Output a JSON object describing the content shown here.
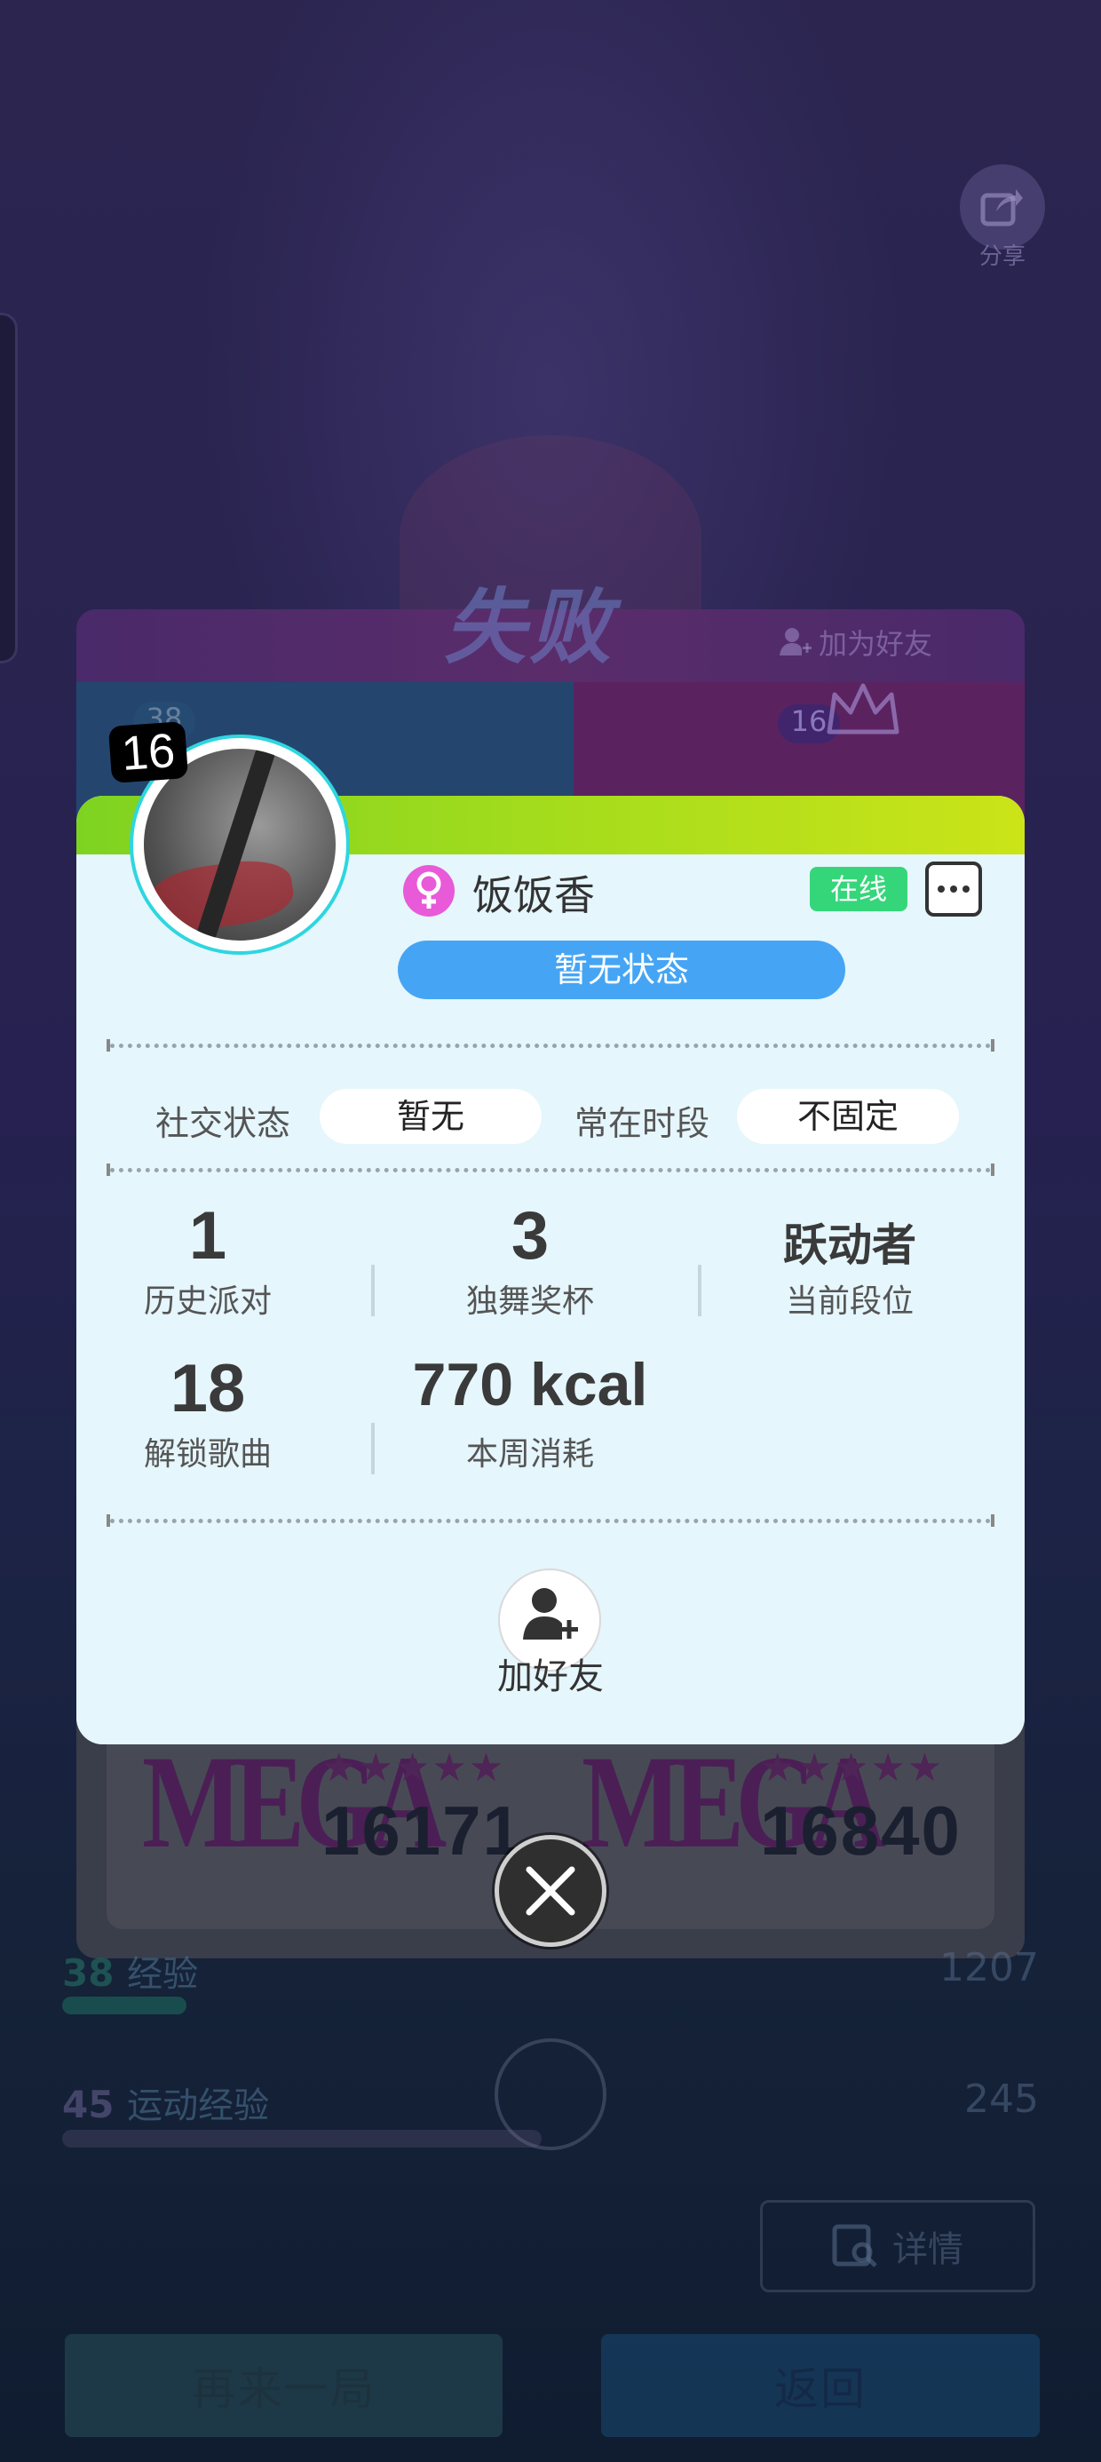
{
  "background": {
    "share_label": "分享",
    "result_title": "失败",
    "add_friend_label": "加为好友",
    "left_level": "38",
    "right_level": "16",
    "left_rating": "MEGA",
    "right_rating": "MEGA",
    "left_stars": "★★★★★",
    "right_stars": "★★★★★",
    "left_score": "16171",
    "right_score": "16840",
    "xp": {
      "level": "38",
      "label": "经验",
      "value": "1207",
      "fill": 0.18
    },
    "sport_xp": {
      "level": "45",
      "label": "运动经验",
      "value": "245",
      "fill": 0.49
    },
    "detail_label": "详情",
    "replay_label": "再来一局",
    "back_label": "返回"
  },
  "profile": {
    "level": "16",
    "username": "饭饭香",
    "gender_icon": "female-icon",
    "online_status": "在线",
    "status_text": "暂无状态",
    "social_status_label": "社交状态",
    "social_status_value": "暂无",
    "active_time_label": "常在时段",
    "active_time_value": "不固定",
    "stats": {
      "parties": {
        "value": "1",
        "label": "历史派对"
      },
      "solo_trophies": {
        "value": "3",
        "label": "独舞奖杯"
      },
      "rank": {
        "value": "跃动者",
        "label": "当前段位"
      },
      "songs_unlocked": {
        "value": "18",
        "label": "解锁歌曲"
      },
      "weekly_kcal": {
        "value": "770 kcal",
        "label": "本周消耗"
      }
    },
    "add_friend_label": "加好友"
  },
  "colors": {
    "header_gradient_start": "#7ed321",
    "header_gradient_end": "#cbe418",
    "status_pill": "#45a5f4",
    "online_badge": "#35d67a",
    "gender_female": "#e85ad8",
    "dialog_bg": "#e5f6fc"
  }
}
